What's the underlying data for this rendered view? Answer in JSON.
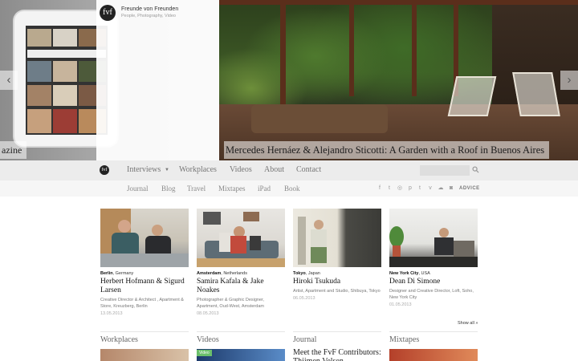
{
  "brand": {
    "logo_text": "fvf",
    "name": "Freunde von Freunden",
    "tagline": "People, Photography, Video"
  },
  "hero": {
    "prev_caption": "azine",
    "caption": "Mercedes Hernáez & Alejandro Sticotti: A Garden with a Roof in Buenos Aires",
    "prev_arrow": "‹",
    "next_arrow": "›"
  },
  "nav": {
    "main": [
      "Interviews",
      "Workplaces",
      "Videos",
      "About",
      "Contact"
    ],
    "caret": "▼",
    "sub": [
      "Journal",
      "Blog",
      "Travel",
      "Mixtapes",
      "iPad",
      "Book"
    ],
    "social_icons": [
      "facebook-icon",
      "twitter-icon",
      "instagram-icon",
      "pinterest-icon",
      "tumblr-icon",
      "vimeo-icon",
      "soundcloud-icon",
      "rss-icon"
    ],
    "social_glyphs": [
      "f",
      "t",
      "◎",
      "p",
      "t",
      "v",
      "☁",
      "◙"
    ],
    "advice": "ADVICE",
    "search_placeholder": ""
  },
  "cards": [
    {
      "city": "Berlin",
      "country": "Germany",
      "title": "Herbert Hofmann & Sigurd Larsen",
      "desc": "Creative Director & Architect , Apartment & Store, Kreuzberg, Berlin",
      "date": "13.05.2013"
    },
    {
      "city": "Amsterdam",
      "country": "Netherlands",
      "title": "Samira Kafala & Jake Noakes",
      "desc": "Photographer & Graphic Designer, Apartment, Oud-West, Amsterdam",
      "date": "08.05.2013"
    },
    {
      "city": "Tokyo",
      "country": "Japan",
      "title": "Hiroki Tsukuda",
      "desc": "Artist, Apartment and Studio, Shibuya, Tokyo",
      "date": "06.05.2013"
    },
    {
      "city": "New York City",
      "country": "USA",
      "title": "Dean Di Simone",
      "desc": "Designer and Creative Director, Loft, Soho, New York City",
      "date": "01.05.2013"
    }
  ],
  "show_all": "Show all »",
  "sections": [
    {
      "title": "Workplaces"
    },
    {
      "title": "Videos",
      "badge": "Video"
    },
    {
      "title": "Journal",
      "headline": "Meet the FvF Contributors: Thijmen Velsen"
    },
    {
      "title": "Mixtapes"
    }
  ],
  "colors": {
    "nav_bg": "#ececec",
    "subnav_bg": "#f6f6f6",
    "video_badge": "#6bbf6b"
  }
}
